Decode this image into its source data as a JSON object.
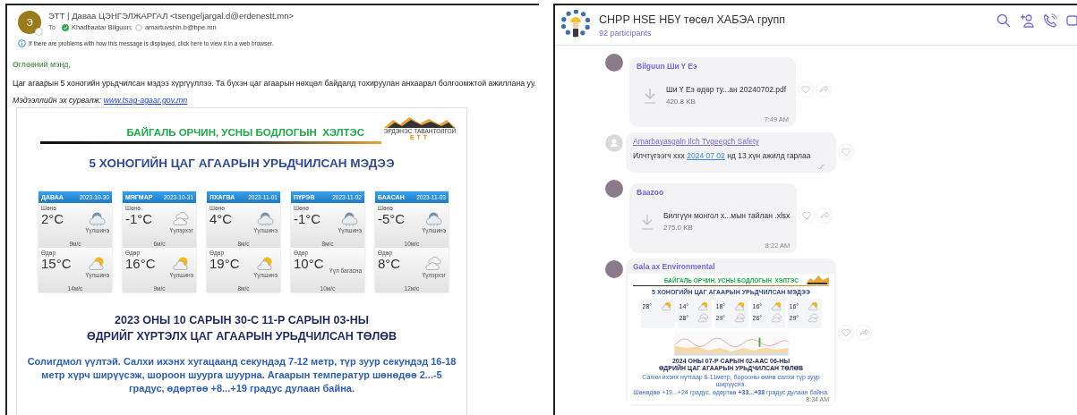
{
  "email": {
    "avatar_initial": "Э",
    "sender": "ЭТТ |  Даваа ЦЭНГЭЛЖАРГАЛ <tsengeljargal.d@erdenestt.mn>",
    "to_label": "To",
    "recipients": [
      {
        "name": "Khadbaatar Bilguun;",
        "online": true
      },
      {
        "name": "amartuvshin.b@bpe.mn",
        "online": false
      }
    ],
    "info": "If there are problems with how this message is displayed, click here to view it in a web browser.",
    "greeting": "Өглөөний мэнд,",
    "body": "Цаг агаарын 5 хоногийн урьдчилсан мэдээ хүргүүллээ. Та бүхэн цаг агаарын нөхцөл байдалд тохируулан анхаарал болгоомжтой ажиллана уу.",
    "source_label": "Мэдээллийн эх сурвалж:",
    "source_link": "www.tsag-agaar.gov.mn",
    "bulletin": {
      "department": "БАЙГАЛЬ ОРЧИН, УСНЫ БОДЛОГЫН  ХЭЛТЭС",
      "logo_name": "ЭРДЭНЭС ТАВАНТОЛГОЙ",
      "logo_mark": "ЕТТ",
      "title": "5 ХОНОГИЙН ЦАГ АГААРЫН УРЬДЧИЛСАН МЭДЭЭ",
      "days": [
        {
          "day": "ДАВАА",
          "date": "2023-10-30",
          "night": {
            "label": "Шөнө",
            "temp": "2°C",
            "kind": "snow-cloud",
            "condition": "Үүлшинэ",
            "wind": "9м/с"
          },
          "daytime": {
            "label": "Өдөр",
            "temp": "15°C",
            "kind": "sun-cloud",
            "condition": "Үүлшинэ",
            "wind": "14м/с"
          }
        },
        {
          "day": "МЯГМАР",
          "date": "2023-10-31",
          "night": {
            "label": "Шөнө",
            "temp": "-1°C",
            "kind": "cloud",
            "condition": "Үүлэрхэг",
            "wind": "6м/с"
          },
          "daytime": {
            "label": "Өдөр",
            "temp": "16°C",
            "kind": "sun-cloud",
            "condition": "Үүлшинэ",
            "wind": "9м/с"
          }
        },
        {
          "day": "ЛХАГВА",
          "date": "2023-11-01",
          "night": {
            "label": "Шөнө",
            "temp": "4°C",
            "kind": "snow-cloud",
            "condition": "Үүлшинэ",
            "wind": "8м/с"
          },
          "daytime": {
            "label": "Өдөр",
            "temp": "19°C",
            "kind": "sun-cloud",
            "condition": "Үүлшинэ",
            "wind": "8м/с"
          }
        },
        {
          "day": "ПҮРЭВ",
          "date": "2023-11-02",
          "night": {
            "label": "Шөнө",
            "temp": "-1°C",
            "kind": "snow-cloud",
            "condition": "Үүлшинэ",
            "wind": "8м/с"
          },
          "daytime": {
            "label": "Өдөр",
            "temp": "10°C",
            "kind": "text-only",
            "condition": "Үүл багасна",
            "wind": "10м/с"
          }
        },
        {
          "day": "БААСАН",
          "date": "2023-11-03",
          "night": {
            "label": "Шөнө",
            "temp": "-5°C",
            "kind": "snow-cloud",
            "condition": "Үүлшинэ",
            "wind": "10м/с"
          },
          "daytime": {
            "label": "Өдөр",
            "temp": "8°C",
            "kind": "cloud",
            "condition": "Үүлэрхэг",
            "wind": "12м/с"
          }
        }
      ],
      "headline": [
        "2023 ОНЫ 10 САРЫН 30-С 11-Р САРЫН 03-НЫ",
        "ӨДРИЙГ ХҮРТЭЛХ ЦАГ АГААРЫН УРЬДЧИЛСАН ТӨЛӨВ"
      ],
      "summary": "Солигдмол үүлтэй. Салхи ихэнх хугацаанд секундэд 7-12 метр, түр зуур секундэд **16-18 метр хүрч ширүүсэж**, шороон шуурга шуурна. Агаарын температур шөнөдөө 2...-5 градус, өдөртөө +8...+19 градус дулаан байна."
    }
  },
  "chat": {
    "title": "CHPP HSE НБҮ төсөл ХАБЭА групп",
    "participants": "92 participants",
    "messages": [
      {
        "kind": "file",
        "avatar": {
          "kind": "photo"
        },
        "sender": "Bilguun Ши Ү Еэ",
        "sender_underlined": false,
        "file_name": "Ши Ү Еэ өдөр ту...ан 20240702.pdf",
        "file_size": "420.8 KB",
        "time": "7:49 AM",
        "actions": [
          {
            "kind": "like"
          },
          {
            "kind": "share"
          }
        ]
      },
      {
        "kind": "text",
        "avatar": {
          "kind": "default"
        },
        "sender": "Amarbayasgaln Ilch Tvgeegch Safety",
        "sender_underlined": true,
        "text_before": "Илчтүгээгч  xxx ",
        "link": "2024 07 02",
        "text_after": " нд 13 хүн ажилд гарлаа",
        "actions": [
          {
            "kind": "like"
          }
        ]
      },
      {
        "kind": "file",
        "avatar": {
          "kind": "photo"
        },
        "sender": "Baazoo",
        "sender_underlined": false,
        "file_name": "Билгүүн монгол х...мын тайлан .xlsx",
        "file_size": "275.0 KB",
        "time": "8:22 AM",
        "actions": [
          {
            "kind": "like"
          },
          {
            "kind": "share"
          }
        ]
      },
      {
        "kind": "image",
        "avatar": {
          "kind": "photo"
        },
        "sender": "Gala ax Environmental",
        "sender_underlined": false,
        "time": "8:34 AM",
        "actions": [
          {
            "kind": "like"
          },
          {
            "kind": "share"
          }
        ],
        "image": {
          "department": "БАЙГАЛЬ ОРЧИН, УСНЫ БОДЛОГЫН  ХЭЛТЭС",
          "title": "5 ХОНОГИЙН ЦАГ АГААРЫН УРЬДЧИЛСАН МЭДЭЭ",
          "days": [
            {
              "night": "28°"
            },
            {
              "night": "14°",
              "day": "28°"
            },
            {
              "night": "18°",
              "day": "29°"
            },
            {
              "night": "16°",
              "day": "26°"
            },
            {
              "night": "16°",
              "day": "29°"
            }
          ],
          "headline": [
            "2024 ОНЫ 07-Р САРЫН 02-ААС 06-НЫ",
            "ӨДРИЙН ЦАГ АГААРЫН УРЬДЧИЛСАН ТӨЛӨВ"
          ],
          "summary": [
            "Салхи ихэнх нутгаар 6-11метр, борооны өмнө салхи түр зуур ширүүснэ.",
            "Шөнөдөө +19...+24 градус, өдөртөө **+33...+38** градус дулаан байна."
          ]
        }
      }
    ]
  }
}
